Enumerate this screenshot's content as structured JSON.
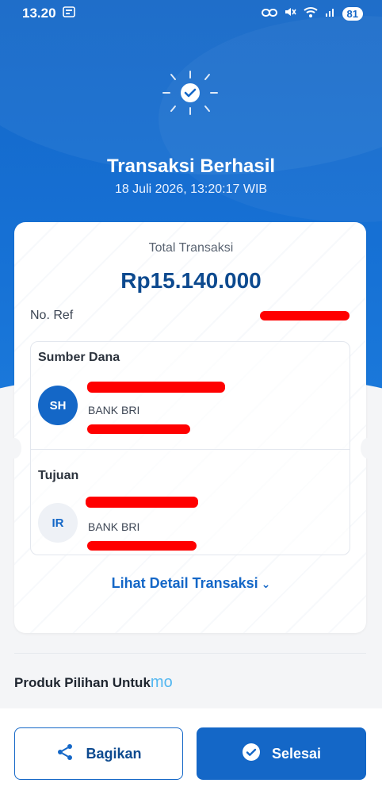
{
  "status_bar": {
    "time": "13.20",
    "battery": "81"
  },
  "header": {
    "title": "Transaksi Berhasil",
    "datetime": "18 Juli 2026, 13:20:17 WIB"
  },
  "receipt": {
    "total_label": "Total Transaksi",
    "total_amount": "Rp15.140.000",
    "ref_label": "No. Ref",
    "source": {
      "section_label": "Sumber Dana",
      "initials": "SH",
      "bank": "BANK BRI"
    },
    "destination": {
      "section_label": "Tujuan",
      "initials": "IR",
      "bank": "BANK BRI"
    },
    "detail_link": "Lihat Detail Transaksi"
  },
  "promo": {
    "heading": "Produk Pilihan Untuk",
    "brand": "mo"
  },
  "actions": {
    "share_label": "Bagikan",
    "done_label": "Selesai"
  },
  "colors": {
    "primary": "#1467c7",
    "amount": "#0d4a8f",
    "redaction": "#ff0000",
    "brand_mo": "#53b7f0"
  }
}
